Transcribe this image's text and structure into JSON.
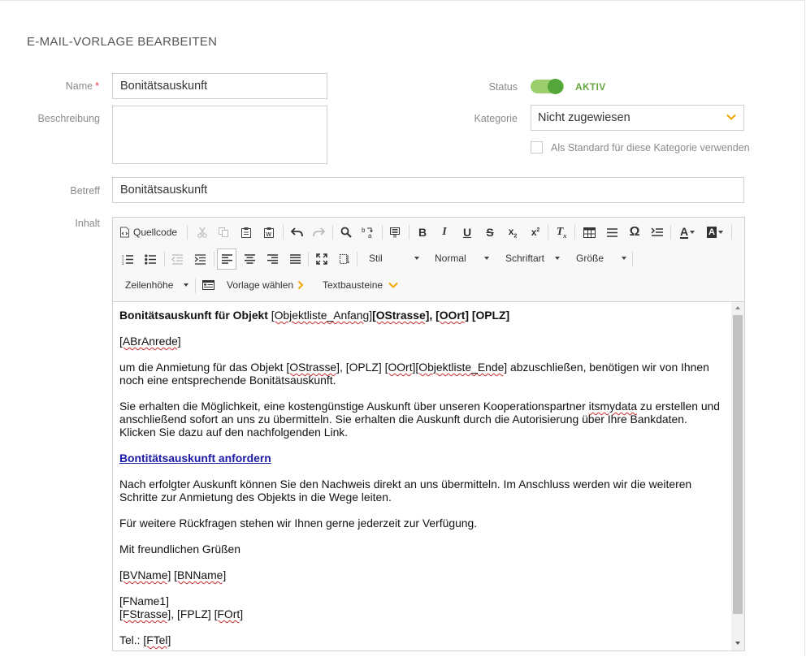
{
  "page": {
    "title": "E-MAIL-VORLAGE BEARBEITEN"
  },
  "form": {
    "name_label": "Name",
    "name_required": "*",
    "name_value": "Bonitätsauskunft",
    "description_label": "Beschreibung",
    "description_value": "",
    "subject_label": "Betreff",
    "subject_value": "Bonitätsauskunft",
    "content_label": "Inhalt",
    "status_label": "Status",
    "status_value": "AKTIV",
    "status_on": true,
    "category_label": "Kategorie",
    "category_value": "Nicht zugewiesen",
    "default_checkbox_label": "Als Standard für diese Kategorie verwenden",
    "default_checked": false
  },
  "toolbar": {
    "source_label": "Quellcode",
    "style_label": "Stil",
    "format_label": "Normal",
    "font_label": "Schriftart",
    "size_label": "Größe",
    "line_height_label": "Zeilenhöhe",
    "template_label": "Vorlage wählen",
    "textblocks_label": "Textbausteine"
  },
  "email_body": {
    "heading_bold": "Bonitätsauskunft für Objekt",
    "heading_ph_start": "[Objektliste_Anfang]",
    "heading_ph_street": "[OStrasse]",
    "heading_comma": ", ",
    "heading_ph_city": "[OOrt]",
    "heading_ph_zip": " [OPLZ]",
    "salutation": "[ABrAnrede]",
    "p1_a": "um die Anmietung für das Objekt ",
    "p1_ph_street": "[OStrasse]",
    "p1_b": ", [OPLZ] ",
    "p1_ph_city": "[OOrt]",
    "p1_ph_end": "[Objektliste_Ende]",
    "p1_c": " abzuschließen, benötigen wir von Ihnen noch eine entsprechende Bonitätsauskunft.",
    "p2_a": "Sie erhalten die Möglichkeit, eine kostengünstige Auskunft über unseren Kooperationspartner ",
    "p2_partner": "itsmydata",
    "p2_b": " zu erstellen und anschließend sofort an uns zu übermitteln. Sie erhalten die Auskunft durch die Autorisierung über Ihre Bankdaten. Klicken Sie dazu auf den nachfolgenden Link.",
    "link": "Bontitätsauskunft anfordern",
    "p3": "Nach erfolgter Auskunft können Sie den Nachweis direkt an uns übermitteln. Im Anschluss werden wir die weiteren Schritte zur Anmietung des Objekts in die Wege leiten.",
    "p4": "Für weitere Rückfragen stehen wir Ihnen gerne jederzeit zur Verfügung.",
    "closing": "Mit freundlichen Grüßen",
    "sig_first": "[BVName]",
    "sig_last": "[BNName]",
    "firm_name": "[FName1]",
    "firm_street": "[FStrasse]",
    "firm_zip": ", [FPLZ] ",
    "firm_city": "[FOrt]",
    "tel_label": "Tel.: ",
    "tel_ph": "[FTel]"
  },
  "colors": {
    "accent_green": "#66a53b",
    "toggle_track": "#9ccf6c",
    "chevron_orange": "#f0a500",
    "link_blue": "#1a1aa6",
    "required_red": "#e0433b"
  },
  "icons": [
    "source-icon",
    "cut-icon",
    "copy-icon",
    "paste-icon",
    "paste-word-icon",
    "undo-icon",
    "redo-icon",
    "find-icon",
    "replace-icon",
    "select-all-icon",
    "bold-icon",
    "italic-icon",
    "underline-icon",
    "strike-icon",
    "subscript-icon",
    "superscript-icon",
    "remove-format-icon",
    "table-icon",
    "horizontal-line-icon",
    "special-char-icon",
    "insert-field-icon",
    "text-color-icon",
    "bg-color-icon",
    "numbered-list-icon",
    "bullet-list-icon",
    "outdent-icon",
    "indent-icon",
    "align-left-icon",
    "align-center-icon",
    "align-right-icon",
    "align-justify-icon",
    "maximize-icon",
    "show-blocks-icon",
    "template-icon"
  ]
}
